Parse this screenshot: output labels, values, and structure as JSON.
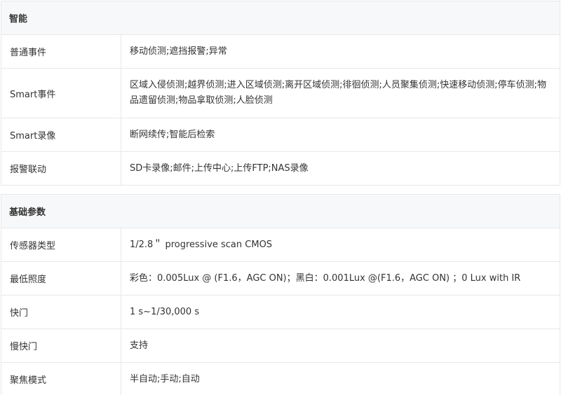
{
  "sections": [
    {
      "title": "智能",
      "rows": [
        {
          "label": "普通事件",
          "value": "移动侦测;遮挡报警;异常"
        },
        {
          "label": "Smart事件",
          "value": "区域入侵侦测;越界侦测;进入区域侦测;离开区域侦测;徘徊侦测;人员聚集侦测;快速移动侦测;停车侦测;物品遗留侦测;物品拿取侦测;人脸侦测"
        },
        {
          "label": "Smart录像",
          "value": "断网续传;智能后检索"
        },
        {
          "label": "报警联动",
          "value": "SD卡录像;邮件;上传中心;上传FTP;NAS录像"
        }
      ]
    },
    {
      "title": "基础参数",
      "rows": [
        {
          "label": "传感器类型",
          "value": "1/2.8＂ progressive scan CMOS"
        },
        {
          "label": "最低照度",
          "value": "彩色：0.005Lux @ (F1.6，AGC ON)；黑白：0.001Lux @(F1.6，AGC ON) ；0 Lux with IR"
        },
        {
          "label": "快门",
          "value": "1 s~1/30,000 s"
        },
        {
          "label": "慢快门",
          "value": "支持"
        },
        {
          "label": "聚焦模式",
          "value": "半自动;手动;自动"
        }
      ]
    }
  ]
}
